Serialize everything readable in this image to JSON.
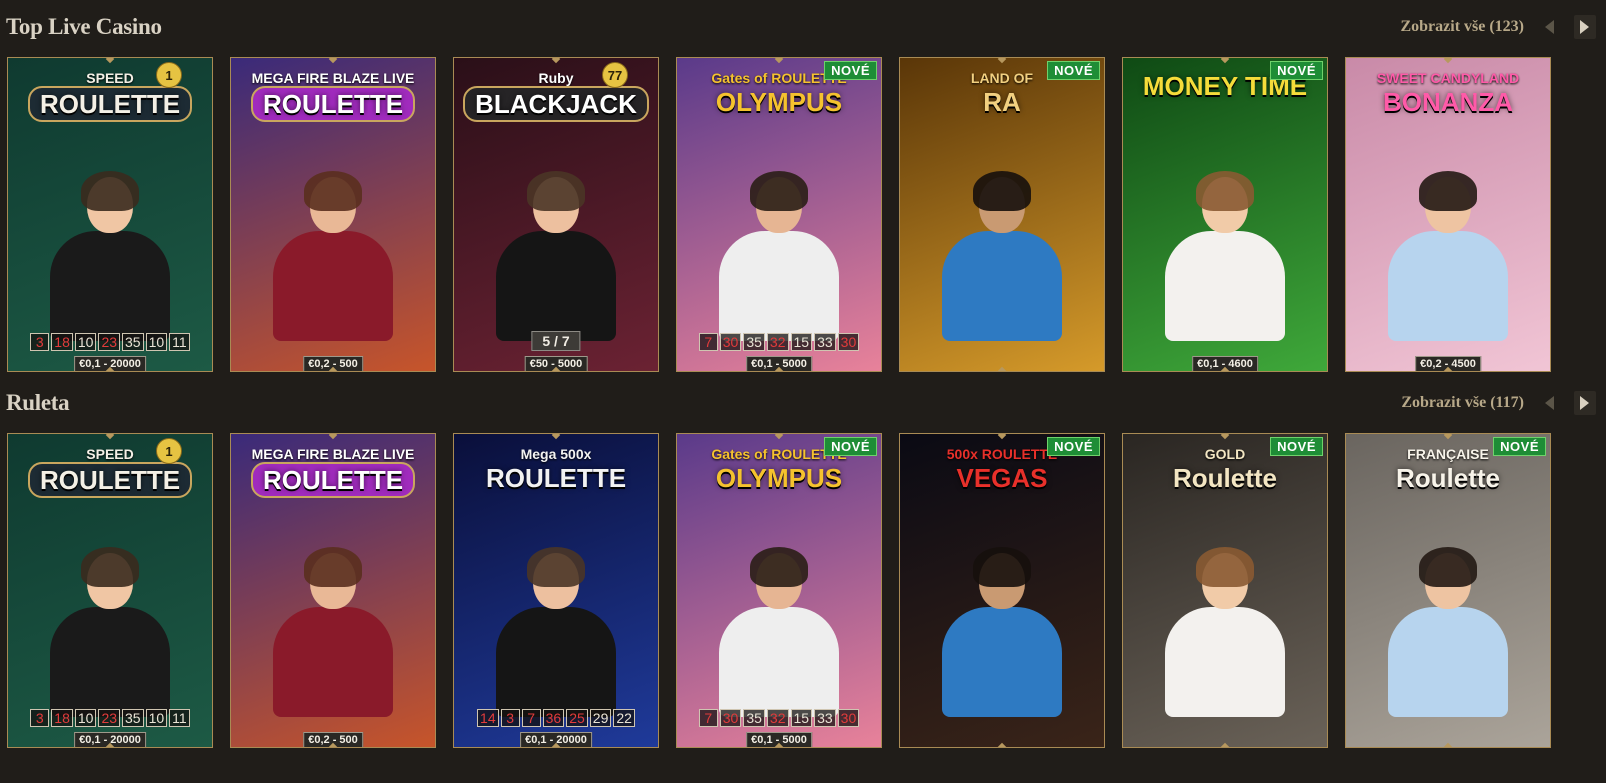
{
  "sections": [
    {
      "title": "Top Live Casino",
      "view_all": "Zobrazit vše (123)",
      "cards": [
        {
          "title": "ROULETTE",
          "subtitle": "SPEED",
          "badge": "1",
          "new": "",
          "results": [
            [
              "3",
              "red"
            ],
            [
              "18",
              "red"
            ],
            [
              "10",
              "black"
            ],
            [
              "23",
              "red"
            ],
            [
              "35",
              "black"
            ],
            [
              "10",
              "black"
            ],
            [
              "11",
              "black"
            ]
          ],
          "seats": "",
          "limit": "€0,1 - 20000",
          "bg": [
            "#0f3a30",
            "#1d5a45"
          ],
          "title_color": "#f4f0e6",
          "plate": "#1d2b34"
        },
        {
          "title": "ROULETTE",
          "subtitle": "MEGA FIRE BLAZE LIVE",
          "badge": "",
          "new": "",
          "results": [],
          "seats": "",
          "limit": "€0,2 - 500",
          "bg": [
            "#3a2a7a",
            "#c7552a"
          ],
          "title_color": "#ffffff",
          "plate": "#a02bbd"
        },
        {
          "title": "BLACKJACK",
          "subtitle": "Ruby",
          "badge": "77",
          "new": "",
          "results": [],
          "seats": "5 / 7",
          "limit": "€50 - 5000",
          "bg": [
            "#2a0f18",
            "#6b2233"
          ],
          "title_color": "#ffffff",
          "plate": "#262426"
        },
        {
          "title": "OLYMPUS",
          "subtitle": "Gates of ROULETTE",
          "badge": "",
          "new": "NOVÉ",
          "results": [
            [
              "7",
              "red"
            ],
            [
              "30",
              "red"
            ],
            [
              "35",
              "black"
            ],
            [
              "32",
              "red"
            ],
            [
              "15",
              "black"
            ],
            [
              "33",
              "black"
            ],
            [
              "30",
              "red"
            ]
          ],
          "seats": "",
          "limit": "€0,1 - 5000",
          "bg": [
            "#5a3a8a",
            "#e8829a"
          ],
          "title_color": "#f5c22e",
          "plate": ""
        },
        {
          "title": "RA",
          "subtitle": "LAND OF",
          "badge": "",
          "new": "NOVÉ",
          "results": [],
          "seats": "",
          "limit": "",
          "bg": [
            "#5a3608",
            "#d59a2a"
          ],
          "title_color": "#f2d080",
          "plate": ""
        },
        {
          "title": "MONEY TIME",
          "subtitle": "",
          "badge": "",
          "new": "NOVÉ",
          "results": [],
          "seats": "",
          "limit": "€0,1 - 4600",
          "bg": [
            "#0f4a14",
            "#3fa83a"
          ],
          "title_color": "#f5dc3a",
          "plate": ""
        },
        {
          "title": "BONANZA",
          "subtitle": "SWEET CANDYLAND",
          "badge": "",
          "new": "",
          "results": [],
          "seats": "",
          "limit": "€0,2 - 4500",
          "bg": [
            "#c98aa8",
            "#f1c5d5"
          ],
          "title_color": "#ff5aa8",
          "plate": ""
        }
      ]
    },
    {
      "title": "Ruleta",
      "view_all": "Zobrazit vše (117)",
      "cards": [
        {
          "title": "ROULETTE",
          "subtitle": "SPEED",
          "badge": "1",
          "new": "",
          "results": [
            [
              "3",
              "red"
            ],
            [
              "18",
              "red"
            ],
            [
              "10",
              "black"
            ],
            [
              "23",
              "red"
            ],
            [
              "35",
              "black"
            ],
            [
              "10",
              "black"
            ],
            [
              "11",
              "black"
            ]
          ],
          "seats": "",
          "limit": "€0,1 - 20000",
          "bg": [
            "#0f3a30",
            "#1d5a45"
          ],
          "title_color": "#f4f0e6",
          "plate": "#1d2b34"
        },
        {
          "title": "ROULETTE",
          "subtitle": "MEGA FIRE BLAZE LIVE",
          "badge": "",
          "new": "",
          "results": [],
          "seats": "",
          "limit": "€0,2 - 500",
          "bg": [
            "#3a2a7a",
            "#c7552a"
          ],
          "title_color": "#ffffff",
          "plate": "#a02bbd"
        },
        {
          "title": "ROULETTE",
          "subtitle": "Mega 500x",
          "badge": "",
          "new": "",
          "results": [
            [
              "14",
              "red"
            ],
            [
              "3",
              "red"
            ],
            [
              "7",
              "red"
            ],
            [
              "36",
              "red"
            ],
            [
              "25",
              "red"
            ],
            [
              "29",
              "black"
            ],
            [
              "22",
              "black"
            ]
          ],
          "seats": "",
          "limit": "€0,1 - 20000",
          "bg": [
            "#0a0f3a",
            "#1f3a9a"
          ],
          "title_color": "#f2f2f2",
          "plate": ""
        },
        {
          "title": "OLYMPUS",
          "subtitle": "Gates of ROULETTE",
          "badge": "",
          "new": "NOVÉ",
          "results": [
            [
              "7",
              "red"
            ],
            [
              "30",
              "red"
            ],
            [
              "35",
              "black"
            ],
            [
              "32",
              "red"
            ],
            [
              "15",
              "black"
            ],
            [
              "33",
              "black"
            ],
            [
              "30",
              "red"
            ]
          ],
          "seats": "",
          "limit": "€0,1 - 5000",
          "bg": [
            "#5a3a8a",
            "#e8829a"
          ],
          "title_color": "#f5c22e",
          "plate": ""
        },
        {
          "title": "VEGAS",
          "subtitle": "500x ROULETTE",
          "badge": "",
          "new": "NOVÉ",
          "results": [],
          "seats": "",
          "limit": "",
          "bg": [
            "#0a0a14",
            "#3a2418"
          ],
          "title_color": "#e8302a",
          "plate": ""
        },
        {
          "title": "Roulette",
          "subtitle": "GOLD",
          "badge": "",
          "new": "NOVÉ",
          "results": [],
          "seats": "",
          "limit": "",
          "bg": [
            "#2a2622",
            "#6a6258"
          ],
          "title_color": "#f3e6c3",
          "plate": ""
        },
        {
          "title": "Roulette",
          "subtitle": "FRANÇAISE",
          "badge": "",
          "new": "NOVÉ",
          "results": [],
          "seats": "",
          "limit": "",
          "bg": [
            "#6a655f",
            "#aba49a"
          ],
          "title_color": "#f8f4ea",
          "plate": ""
        }
      ]
    }
  ],
  "icons": {
    "prev": "chevron-left-icon",
    "next": "chevron-right-icon"
  }
}
